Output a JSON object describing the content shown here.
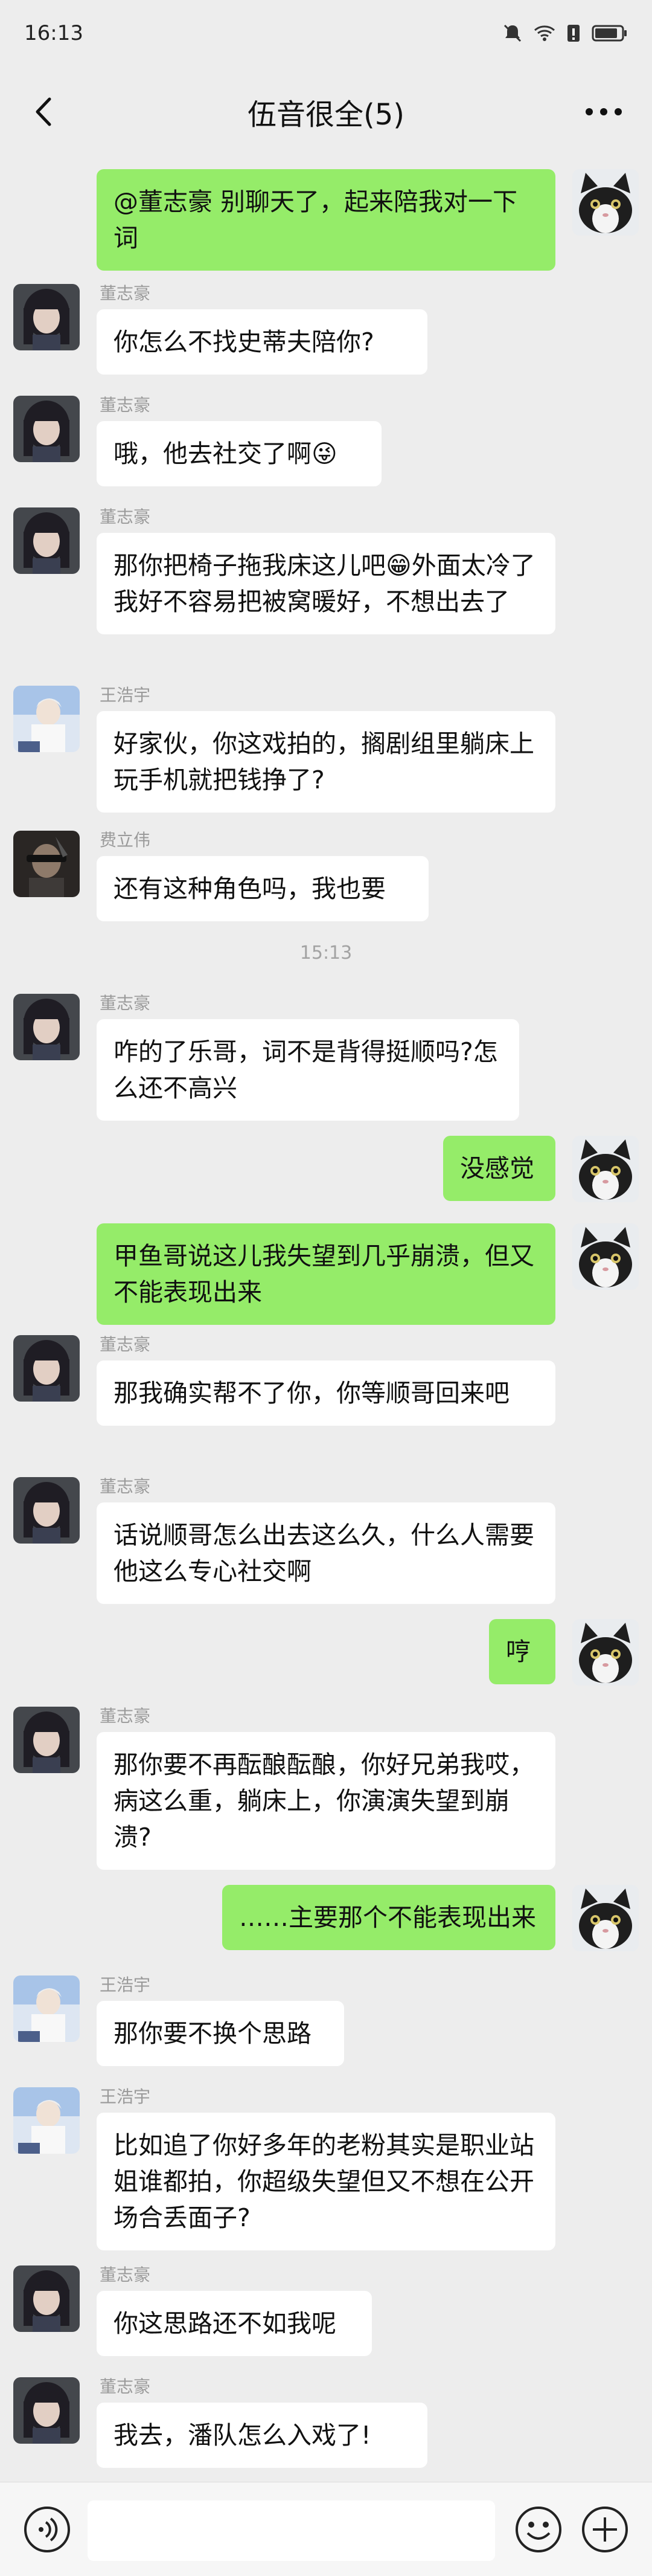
{
  "status": {
    "time": "16:13"
  },
  "header": {
    "title": "伍音很全(5)"
  },
  "timestamp_1": "15:13",
  "senders": {
    "dzh": "董志豪",
    "whz": "王浩宇",
    "flw": "费立伟"
  },
  "messages": {
    "m1": "@董志豪 别聊天了，起来陪我对一下词",
    "m2": "你怎么不找史蒂夫陪你?",
    "m3": "哦，他去社交了啊😜",
    "m4": "那你把椅子拖我床这儿吧😁外面太冷了我好不容易把被窝暖好，不想出去了",
    "m5": "好家伙，你这戏拍的，搁剧组里躺床上玩手机就把钱挣了?",
    "m6": "还有这种角色吗，我也要",
    "m7": "咋的了乐哥，词不是背得挺顺吗?怎么还不高兴",
    "m8": "没感觉",
    "m9": "甲鱼哥说这儿我失望到几乎崩溃，但又不能表现出来",
    "m10": "那我确实帮不了你，你等顺哥回来吧",
    "m11": "话说顺哥怎么出去这么久，什么人需要他这么专心社交啊",
    "m12": "哼",
    "m13": "那你要不再酝酿酝酿，你好兄弟我哎，病这么重，躺床上，你演演失望到崩溃?",
    "m14": "……主要那个不能表现出来",
    "m15": "那你要不换个思路",
    "m16": "比如追了你好多年的老粉其实是职业站姐谁都拍，你超级失望但又不想在公开场合丢面子?",
    "m17": "你这思路还不如我呢",
    "m18": "我去，潘队怎么入戏了!"
  },
  "icons": {
    "back": "back-arrow-icon",
    "more": "more-icon",
    "voice": "voice-icon",
    "emoji": "emoji-icon",
    "plus": "plus-icon"
  },
  "colors": {
    "bg": "#ededed",
    "self_bubble": "#95ec69",
    "other_bubble": "#ffffff"
  }
}
